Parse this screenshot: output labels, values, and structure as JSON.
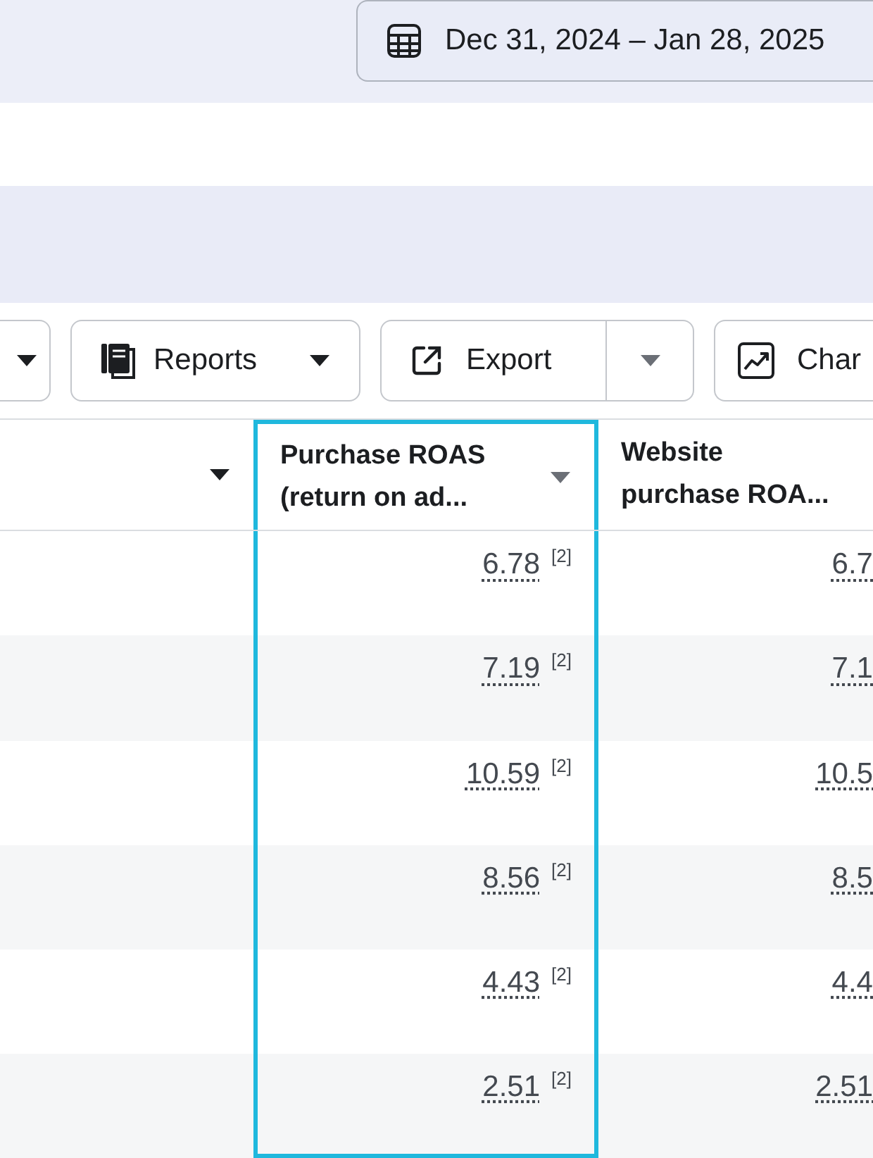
{
  "date_range": {
    "label": "Dec 31, 2024 – Jan 28, 2025"
  },
  "toolbar": [
    {
      "kind": "dropdown"
    },
    {
      "kind": "menu",
      "label": "Reports"
    },
    {
      "kind": "split",
      "label": "Export"
    },
    {
      "kind": "plain",
      "label": "Char"
    }
  ],
  "table": {
    "columns": [
      {
        "sortable": true,
        "selected": false
      },
      {
        "label": "Purchase ROAS\n(return on ad...",
        "sortable": true,
        "selected": true
      },
      {
        "label": "Website\npurchase ROA...",
        "sortable": false,
        "selected": false
      }
    ],
    "rows": [
      {
        "roas": "6.78",
        "note": "[2]",
        "website_roas": "6.7"
      },
      {
        "roas": "7.19",
        "note": "[2]",
        "website_roas": "7.1"
      },
      {
        "roas": "10.59",
        "note": "[2]",
        "website_roas": "10.5"
      },
      {
        "roas": "8.56",
        "note": "[2]",
        "website_roas": "8.5"
      },
      {
        "roas": "4.43",
        "note": "[2]",
        "website_roas": "4.4"
      },
      {
        "roas": "2.51",
        "note": "[2]",
        "website_roas": "2.51"
      }
    ]
  }
}
